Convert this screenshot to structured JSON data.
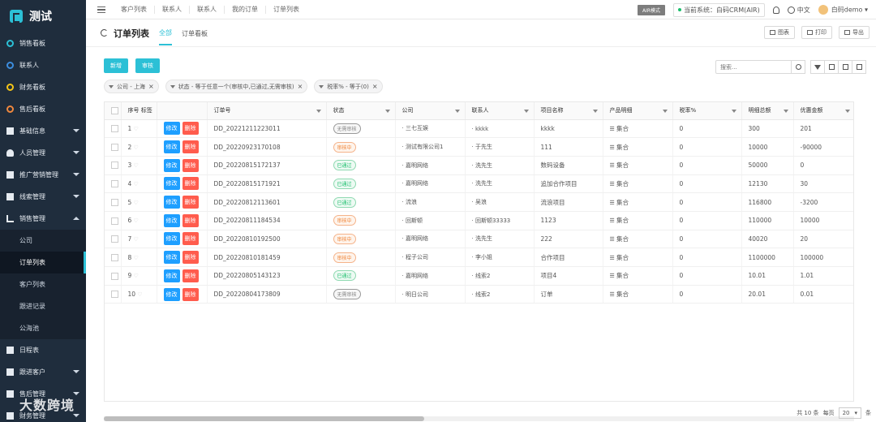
{
  "app": {
    "logo_text": "测试"
  },
  "sidebar": {
    "items": [
      {
        "label": "销售看板",
        "icon": "ring-teal-icon"
      },
      {
        "label": "联系人",
        "icon": "ring-blue-icon"
      },
      {
        "label": "财务看板",
        "icon": "ring-yellow-icon"
      },
      {
        "label": "售后看板",
        "icon": "ring-orange-icon"
      },
      {
        "label": "基础信息",
        "icon": "grid-icon"
      },
      {
        "label": "人员管理",
        "icon": "person-icon"
      },
      {
        "label": "推广营销管理",
        "icon": "grid-icon"
      },
      {
        "label": "线索管理",
        "icon": "grid-icon"
      },
      {
        "label": "销售管理",
        "icon": "bar-chart-icon"
      }
    ],
    "sub_items": [
      "公司",
      "订单列表",
      "客户列表",
      "跟进记录",
      "公海池"
    ],
    "bottom_items": [
      "日程表",
      "跟进客户",
      "售后管理",
      "财务管理"
    ]
  },
  "topbar": {
    "tabs": [
      "客户列表",
      "联系人",
      "联系人",
      "我的订单",
      "订单列表"
    ],
    "air_badge": "AIR模式",
    "system_label": "当前系统：白码CRM(AIR)",
    "lang": "中文",
    "user": "白码demo"
  },
  "page": {
    "title": "订单列表",
    "tabs": [
      "全部",
      "订单看板"
    ],
    "buttons": [
      "图表",
      "打印",
      "导出"
    ],
    "actions": {
      "add": "新增",
      "audit": "审核"
    },
    "search_placeholder": "搜索...",
    "filters": [
      "公司 - 上海",
      "状态 - 等于任意一个(审核中,已通过,无需审核)",
      "税率% - 等于(0)"
    ]
  },
  "table": {
    "headers": {
      "seq": "序号",
      "tag": "标签",
      "order_no": "订单号",
      "status": "状态",
      "company": "公司",
      "contact": "联系人",
      "project": "项目名称",
      "product": "产品明细",
      "tax": "税率%",
      "total": "明细总额",
      "discount": "优惠金额"
    },
    "edit_label": "修改",
    "delete_label": "删除",
    "rows": [
      {
        "seq": "1",
        "order_no": "DD_20221211223011",
        "status": "无需审核",
        "status_type": "none",
        "company": "三七互娱",
        "contact": "kkkk",
        "project": "kkkk",
        "product": "集合",
        "tax": "0",
        "total": "300",
        "discount": "201"
      },
      {
        "seq": "2",
        "order_no": "DD_20220923170108",
        "status": "审核中",
        "status_type": "pend",
        "company": "测试有限公司1",
        "contact": "于先生",
        "project": "111",
        "product": "集合",
        "tax": "0",
        "total": "10000",
        "discount": "-90000"
      },
      {
        "seq": "3",
        "order_no": "DD_20220815172137",
        "status": "已通过",
        "status_type": "pass",
        "company": "嘉明网络",
        "contact": "洗先生",
        "project": "数码设备",
        "product": "集合",
        "tax": "0",
        "total": "50000",
        "discount": "0"
      },
      {
        "seq": "4",
        "order_no": "DD_20220815171921",
        "status": "已通过",
        "status_type": "pass",
        "company": "嘉明网络",
        "contact": "洗先生",
        "project": "追加合作项目",
        "product": "集合",
        "tax": "0",
        "total": "12130",
        "discount": "30"
      },
      {
        "seq": "5",
        "order_no": "DD_20220812113601",
        "status": "已通过",
        "status_type": "pass",
        "company": "流浪",
        "contact": "吴浪",
        "project": "流浪项目",
        "product": "集合",
        "tax": "0",
        "total": "116800",
        "discount": "-3200"
      },
      {
        "seq": "6",
        "order_no": "DD_20220811184534",
        "status": "审核中",
        "status_type": "pend",
        "company": "回斯顿",
        "contact": "回斯顿33333",
        "project": "1123",
        "product": "集合",
        "tax": "0",
        "total": "110000",
        "discount": "10000"
      },
      {
        "seq": "7",
        "order_no": "DD_20220810192500",
        "status": "审核中",
        "status_type": "pend",
        "company": "嘉明网络",
        "contact": "洗先生",
        "project": "222",
        "product": "集合",
        "tax": "0",
        "total": "40020",
        "discount": "20"
      },
      {
        "seq": "8",
        "order_no": "DD_20220810181459",
        "status": "审核中",
        "status_type": "pend",
        "company": "程子公司",
        "contact": "李小姐",
        "project": "合作项目",
        "product": "集合",
        "tax": "0",
        "total": "1100000",
        "discount": "100000"
      },
      {
        "seq": "9",
        "order_no": "DD_20220805143123",
        "status": "已通过",
        "status_type": "pass",
        "company": "嘉明网络",
        "contact": "线索2",
        "project": "项目4",
        "product": "集合",
        "tax": "0",
        "total": "10.01",
        "discount": "1.01"
      },
      {
        "seq": "10",
        "order_no": "DD_20220804173809",
        "status": "无需审核",
        "status_type": "none",
        "company": "明日公司",
        "contact": "线索2",
        "project": "订单",
        "product": "集合",
        "tax": "0",
        "total": "20.01",
        "discount": "0.01"
      }
    ]
  },
  "pager": {
    "total": "共 10 条",
    "per_page_label": "每页",
    "per_page": "20",
    "unit": "条"
  },
  "watermark": "大数跨境"
}
